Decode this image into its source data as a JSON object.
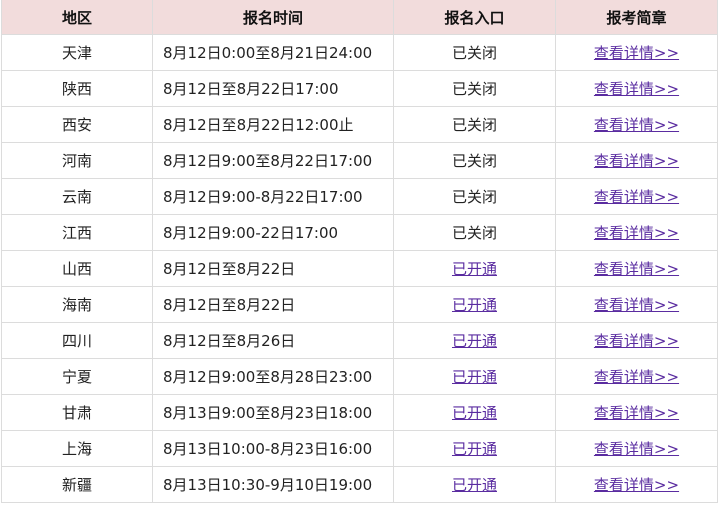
{
  "headers": [
    "地区",
    "报名时间",
    "报名入口",
    "报考简章"
  ],
  "rows": [
    {
      "region": "天津",
      "time": "8月12日0:00至8月21日24:00",
      "entry": "已关闭",
      "entry_link": false,
      "brochure": "查看详情>>"
    },
    {
      "region": "陕西",
      "time": "8月12日至8月22日17:00",
      "entry": "已关闭",
      "entry_link": false,
      "brochure": "查看详情>>"
    },
    {
      "region": "西安",
      "time": "8月12日至8月22日12:00止",
      "entry": "已关闭",
      "entry_link": false,
      "brochure": "查看详情>>"
    },
    {
      "region": "河南",
      "time": "8月12日9:00至8月22日17:00",
      "entry": "已关闭",
      "entry_link": false,
      "brochure": "查看详情>>"
    },
    {
      "region": "云南",
      "time": "8月12日9:00-8月22日17:00",
      "entry": "已关闭",
      "entry_link": false,
      "brochure": "查看详情>>"
    },
    {
      "region": "江西",
      "time": "8月12日9:00-22日17:00",
      "entry": "已关闭",
      "entry_link": false,
      "brochure": "查看详情>>"
    },
    {
      "region": "山西",
      "time": "8月12日至8月22日",
      "entry": "已开通",
      "entry_link": true,
      "brochure": "查看详情>>"
    },
    {
      "region": "海南",
      "time": "8月12日至8月22日",
      "entry": "已开通",
      "entry_link": true,
      "brochure": "查看详情>>"
    },
    {
      "region": "四川",
      "time": "8月12日至8月26日",
      "entry": "已开通",
      "entry_link": true,
      "brochure": "查看详情>>"
    },
    {
      "region": "宁夏",
      "time": "8月12日9:00至8月28日23:00",
      "entry": "已开通",
      "entry_link": true,
      "brochure": "查看详情>>"
    },
    {
      "region": "甘肃",
      "time": "8月13日9:00至8月23日18:00",
      "entry": "已开通",
      "entry_link": true,
      "brochure": "查看详情>>"
    },
    {
      "region": "上海",
      "time": "8月13日10:00-8月23日16:00",
      "entry": "已开通",
      "entry_link": true,
      "brochure": "查看详情>>"
    },
    {
      "region": "新疆",
      "time": "8月13日10:30-9月10日19:00",
      "entry": "已开通",
      "entry_link": true,
      "brochure": "查看详情>>"
    }
  ],
  "colors": {
    "header_bg": "#f2dcdc",
    "link": "#5a2ca0",
    "border": "#dcdcdc"
  }
}
